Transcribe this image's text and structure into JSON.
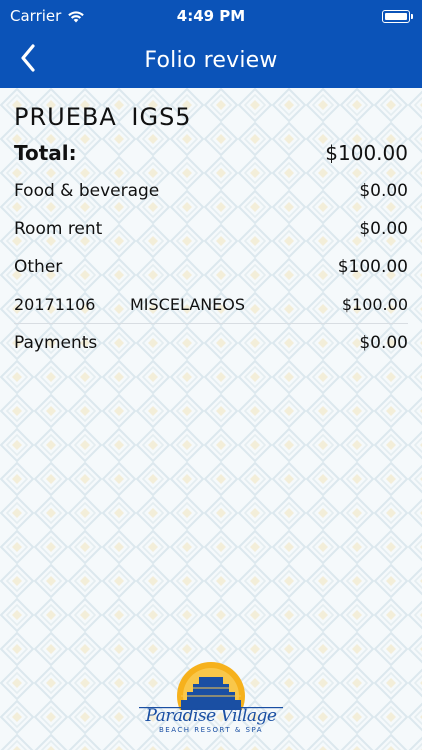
{
  "status_bar": {
    "carrier": "Carrier",
    "time": "4:49 PM"
  },
  "nav": {
    "title": "Folio review"
  },
  "folio": {
    "guest_name": "PRUEBA  IGS5",
    "total_label": "Total:",
    "total_amount": "$100.00",
    "lines": [
      {
        "label": "Food & beverage",
        "amount": "$0.00"
      },
      {
        "label": "Room rent",
        "amount": "$0.00"
      },
      {
        "label": "Other",
        "amount": "$100.00"
      }
    ],
    "details": [
      {
        "date": "20171106",
        "description": "MISCELANEOS",
        "amount": "$100.00"
      }
    ],
    "payments_label": "Payments",
    "payments_amount": "$0.00"
  },
  "logo": {
    "name": "Paradise Village",
    "subtitle": "BEACH RESORT & SPA"
  },
  "colors": {
    "header": "#0b53b8",
    "pattern": "#dfe9ef",
    "logo_blue": "#1a4fa3",
    "logo_sun": "#f6b11c"
  }
}
